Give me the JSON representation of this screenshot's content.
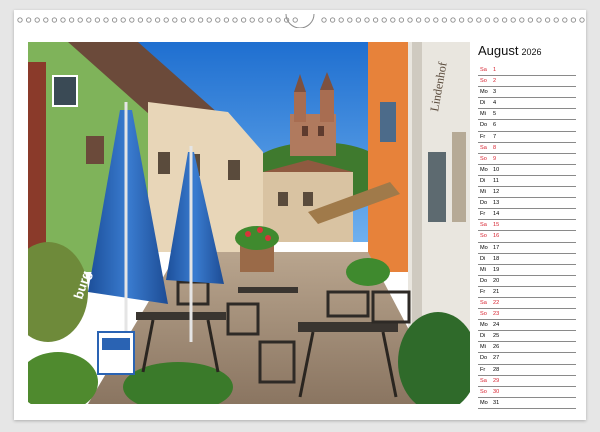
{
  "colors": {
    "weekend": "#d61f2c",
    "weekday": "#222222",
    "rule": "#8a8a8a",
    "sky": "#2d7fd6",
    "umbrella": "#2a63b3"
  },
  "photo": {
    "description_icons": [
      "umbrella-icon",
      "church-icon",
      "chair-icon",
      "table-icon"
    ],
    "umbrella_text": "burg",
    "sign_text": "Lindenhof"
  },
  "calendar": {
    "month": "August",
    "year": "2026",
    "days": [
      {
        "wd": "Sa",
        "d": "1",
        "weekend": true
      },
      {
        "wd": "So",
        "d": "2",
        "weekend": true
      },
      {
        "wd": "Mo",
        "d": "3",
        "weekend": false
      },
      {
        "wd": "Di",
        "d": "4",
        "weekend": false
      },
      {
        "wd": "Mi",
        "d": "5",
        "weekend": false
      },
      {
        "wd": "Do",
        "d": "6",
        "weekend": false
      },
      {
        "wd": "Fr",
        "d": "7",
        "weekend": false
      },
      {
        "wd": "Sa",
        "d": "8",
        "weekend": true
      },
      {
        "wd": "So",
        "d": "9",
        "weekend": true
      },
      {
        "wd": "Mo",
        "d": "10",
        "weekend": false
      },
      {
        "wd": "Di",
        "d": "11",
        "weekend": false
      },
      {
        "wd": "Mi",
        "d": "12",
        "weekend": false
      },
      {
        "wd": "Do",
        "d": "13",
        "weekend": false
      },
      {
        "wd": "Fr",
        "d": "14",
        "weekend": false
      },
      {
        "wd": "Sa",
        "d": "15",
        "weekend": true
      },
      {
        "wd": "So",
        "d": "16",
        "weekend": true
      },
      {
        "wd": "Mo",
        "d": "17",
        "weekend": false
      },
      {
        "wd": "Di",
        "d": "18",
        "weekend": false
      },
      {
        "wd": "Mi",
        "d": "19",
        "weekend": false
      },
      {
        "wd": "Do",
        "d": "20",
        "weekend": false
      },
      {
        "wd": "Fr",
        "d": "21",
        "weekend": false
      },
      {
        "wd": "Sa",
        "d": "22",
        "weekend": true
      },
      {
        "wd": "So",
        "d": "23",
        "weekend": true
      },
      {
        "wd": "Mo",
        "d": "24",
        "weekend": false
      },
      {
        "wd": "Di",
        "d": "25",
        "weekend": false
      },
      {
        "wd": "Mi",
        "d": "26",
        "weekend": false
      },
      {
        "wd": "Do",
        "d": "27",
        "weekend": false
      },
      {
        "wd": "Fr",
        "d": "28",
        "weekend": false
      },
      {
        "wd": "Sa",
        "d": "29",
        "weekend": true
      },
      {
        "wd": "So",
        "d": "30",
        "weekend": true
      },
      {
        "wd": "Mo",
        "d": "31",
        "weekend": false
      }
    ]
  }
}
